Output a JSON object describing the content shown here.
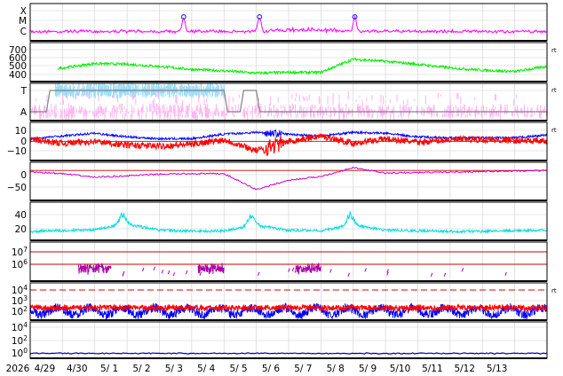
{
  "chart_data": [
    {
      "type": "line",
      "y_tick_labels": [
        "X",
        "M",
        "C"
      ],
      "series": [
        {
          "color": "#ff00ff",
          "baseline": "C",
          "peaks_at_days": [
            4.75,
            7.1,
            10.05
          ]
        }
      ],
      "markers": {
        "color": "#3333ff",
        "symbol": "circle",
        "at_days": [
          4.75,
          7.1,
          10.05
        ]
      }
    },
    {
      "type": "line",
      "y_tick_labels": [
        "700",
        "600",
        "500",
        "400"
      ],
      "ylim": [
        300,
        760
      ],
      "series": [
        {
          "color": "#00ee00",
          "values_per_day": [
            400,
            450,
            510,
            500,
            470,
            430,
            410,
            380,
            390,
            390,
            570,
            540,
            500,
            450,
            420,
            400,
            470
          ]
        }
      ]
    },
    {
      "type": "line",
      "y_tick_labels": [
        "T",
        "A"
      ],
      "series": [
        {
          "color": "#99ddff",
          "level": "T",
          "days": [
            0.75,
            6.0
          ]
        },
        {
          "color": "#ffb3f0",
          "level": "A",
          "days": [
            0.0,
            16.0
          ]
        },
        {
          "color": "#808080",
          "type": "step",
          "levels_per_half_day": [
            "A",
            "T",
            "T",
            "T",
            "T",
            "T",
            "T",
            "T",
            "T",
            "T",
            "T",
            "T",
            "A",
            "T",
            "A",
            "A",
            "A",
            "A",
            "A",
            "A",
            "A",
            "A",
            "A",
            "A",
            "A",
            "A",
            "A",
            "A",
            "A",
            "A",
            "A",
            "A"
          ]
        }
      ]
    },
    {
      "type": "line",
      "y_tick_labels": [
        "10",
        "0",
        "−10"
      ],
      "ylim": [
        -18,
        18
      ],
      "zero_line_color": "#cc0000",
      "series": [
        {
          "color": "#0000ff",
          "values_per_day": [
            3,
            6,
            9,
            5,
            3,
            3,
            8,
            10,
            8,
            6,
            10,
            9,
            5,
            4,
            4,
            4,
            7
          ]
        },
        {
          "color": "#ff0000",
          "values_per_day": [
            2,
            -2,
            0,
            -4,
            -5,
            -3,
            2,
            -10,
            0,
            6,
            -2,
            3,
            -1,
            2,
            2,
            1,
            0
          ]
        }
      ]
    },
    {
      "type": "line",
      "y_tick_labels": [
        "0",
        "−50"
      ],
      "ylim": [
        -100,
        20
      ],
      "zero_line_color": "#cc0000",
      "series": [
        {
          "color": "#cc00cc",
          "values_per_day": [
            -5,
            -12,
            -25,
            -20,
            -14,
            -12,
            -12,
            -70,
            -36,
            -22,
            10,
            -10,
            -8,
            -6,
            -4,
            -2,
            0
          ]
        }
      ]
    },
    {
      "type": "line",
      "y_tick_labels": [
        "40",
        "20"
      ],
      "ylim": [
        0,
        50
      ],
      "series": [
        {
          "color": "#00dddd",
          "values_per_day": [
            8,
            10,
            14,
            32,
            12,
            8,
            10,
            28,
            12,
            10,
            30,
            12,
            10,
            8,
            8,
            10,
            12
          ]
        }
      ]
    },
    {
      "type": "line",
      "y_tick_labels": [
        "10^7",
        "10^6"
      ],
      "y_scale": "log",
      "threshold_lines": {
        "color": "#cc0000",
        "values": [
          "10^7",
          "10^6"
        ]
      },
      "series": [
        {
          "color": "#aa00aa",
          "active_days": [
            1.5,
            2.5,
            5.2,
            6.0,
            8.2,
            9.0
          ]
        }
      ]
    },
    {
      "type": "line",
      "y_tick_labels": [
        "10^4",
        "10^3",
        "10^2"
      ],
      "y_scale": "log",
      "threshold_lines": {
        "color": "#dd0000",
        "style": "dashed",
        "values": [
          "10^4"
        ]
      },
      "series": [
        {
          "color": "#0000ff"
        },
        {
          "color": "#ff0000"
        }
      ]
    },
    {
      "type": "line",
      "y_tick_labels": [
        "10^4",
        "10^2",
        "10^0"
      ],
      "y_scale": "log",
      "series": [
        {
          "color": "#0000cc",
          "level": "10^0"
        }
      ]
    }
  ],
  "x_axis": {
    "tick_labels": [
      "2026",
      "4/29",
      "4/30",
      "5/ 1",
      "5/ 2",
      "5/ 3",
      "5/ 4",
      "5/ 5",
      "5/ 6",
      "5/ 7",
      "5/ 8",
      "5/ 9",
      "5/10",
      "5/11",
      "5/12",
      "5/13"
    ]
  },
  "right_panel_marks": [
    "rt",
    "rt",
    "rt",
    "rt"
  ],
  "colors": {
    "axis": "#000000",
    "grid": "#cfcfcf",
    "background": "#ffffff"
  }
}
